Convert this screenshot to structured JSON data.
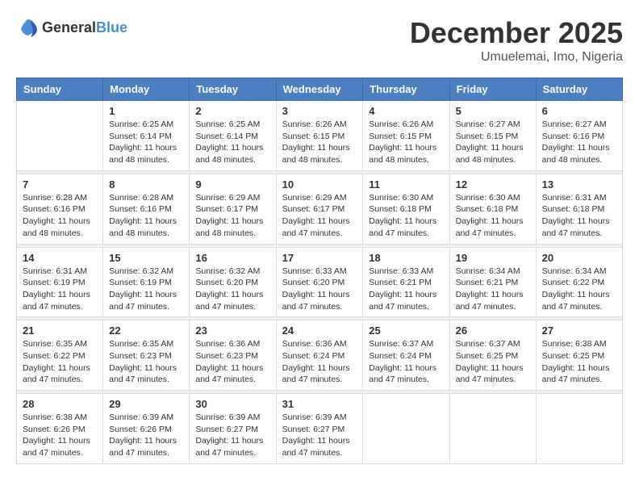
{
  "logo": {
    "general": "General",
    "blue": "Blue"
  },
  "header": {
    "month": "December 2025",
    "location": "Umuelemai, Imo, Nigeria"
  },
  "days_of_week": [
    "Sunday",
    "Monday",
    "Tuesday",
    "Wednesday",
    "Thursday",
    "Friday",
    "Saturday"
  ],
  "weeks": [
    [
      {
        "day": "",
        "info": ""
      },
      {
        "day": "1",
        "info": "Sunrise: 6:25 AM\nSunset: 6:14 PM\nDaylight: 11 hours\nand 48 minutes."
      },
      {
        "day": "2",
        "info": "Sunrise: 6:25 AM\nSunset: 6:14 PM\nDaylight: 11 hours\nand 48 minutes."
      },
      {
        "day": "3",
        "info": "Sunrise: 6:26 AM\nSunset: 6:15 PM\nDaylight: 11 hours\nand 48 minutes."
      },
      {
        "day": "4",
        "info": "Sunrise: 6:26 AM\nSunset: 6:15 PM\nDaylight: 11 hours\nand 48 minutes."
      },
      {
        "day": "5",
        "info": "Sunrise: 6:27 AM\nSunset: 6:15 PM\nDaylight: 11 hours\nand 48 minutes."
      },
      {
        "day": "6",
        "info": "Sunrise: 6:27 AM\nSunset: 6:16 PM\nDaylight: 11 hours\nand 48 minutes."
      }
    ],
    [
      {
        "day": "7",
        "info": "Sunrise: 6:28 AM\nSunset: 6:16 PM\nDaylight: 11 hours\nand 48 minutes."
      },
      {
        "day": "8",
        "info": "Sunrise: 6:28 AM\nSunset: 6:16 PM\nDaylight: 11 hours\nand 48 minutes."
      },
      {
        "day": "9",
        "info": "Sunrise: 6:29 AM\nSunset: 6:17 PM\nDaylight: 11 hours\nand 48 minutes."
      },
      {
        "day": "10",
        "info": "Sunrise: 6:29 AM\nSunset: 6:17 PM\nDaylight: 11 hours\nand 47 minutes."
      },
      {
        "day": "11",
        "info": "Sunrise: 6:30 AM\nSunset: 6:18 PM\nDaylight: 11 hours\nand 47 minutes."
      },
      {
        "day": "12",
        "info": "Sunrise: 6:30 AM\nSunset: 6:18 PM\nDaylight: 11 hours\nand 47 minutes."
      },
      {
        "day": "13",
        "info": "Sunrise: 6:31 AM\nSunset: 6:18 PM\nDaylight: 11 hours\nand 47 minutes."
      }
    ],
    [
      {
        "day": "14",
        "info": "Sunrise: 6:31 AM\nSunset: 6:19 PM\nDaylight: 11 hours\nand 47 minutes."
      },
      {
        "day": "15",
        "info": "Sunrise: 6:32 AM\nSunset: 6:19 PM\nDaylight: 11 hours\nand 47 minutes."
      },
      {
        "day": "16",
        "info": "Sunrise: 6:32 AM\nSunset: 6:20 PM\nDaylight: 11 hours\nand 47 minutes."
      },
      {
        "day": "17",
        "info": "Sunrise: 6:33 AM\nSunset: 6:20 PM\nDaylight: 11 hours\nand 47 minutes."
      },
      {
        "day": "18",
        "info": "Sunrise: 6:33 AM\nSunset: 6:21 PM\nDaylight: 11 hours\nand 47 minutes."
      },
      {
        "day": "19",
        "info": "Sunrise: 6:34 AM\nSunset: 6:21 PM\nDaylight: 11 hours\nand 47 minutes."
      },
      {
        "day": "20",
        "info": "Sunrise: 6:34 AM\nSunset: 6:22 PM\nDaylight: 11 hours\nand 47 minutes."
      }
    ],
    [
      {
        "day": "21",
        "info": "Sunrise: 6:35 AM\nSunset: 6:22 PM\nDaylight: 11 hours\nand 47 minutes."
      },
      {
        "day": "22",
        "info": "Sunrise: 6:35 AM\nSunset: 6:23 PM\nDaylight: 11 hours\nand 47 minutes."
      },
      {
        "day": "23",
        "info": "Sunrise: 6:36 AM\nSunset: 6:23 PM\nDaylight: 11 hours\nand 47 minutes."
      },
      {
        "day": "24",
        "info": "Sunrise: 6:36 AM\nSunset: 6:24 PM\nDaylight: 11 hours\nand 47 minutes."
      },
      {
        "day": "25",
        "info": "Sunrise: 6:37 AM\nSunset: 6:24 PM\nDaylight: 11 hours\nand 47 minutes."
      },
      {
        "day": "26",
        "info": "Sunrise: 6:37 AM\nSunset: 6:25 PM\nDaylight: 11 hours\nand 47 minutes."
      },
      {
        "day": "27",
        "info": "Sunrise: 6:38 AM\nSunset: 6:25 PM\nDaylight: 11 hours\nand 47 minutes."
      }
    ],
    [
      {
        "day": "28",
        "info": "Sunrise: 6:38 AM\nSunset: 6:26 PM\nDaylight: 11 hours\nand 47 minutes."
      },
      {
        "day": "29",
        "info": "Sunrise: 6:39 AM\nSunset: 6:26 PM\nDaylight: 11 hours\nand 47 minutes."
      },
      {
        "day": "30",
        "info": "Sunrise: 6:39 AM\nSunset: 6:27 PM\nDaylight: 11 hours\nand 47 minutes."
      },
      {
        "day": "31",
        "info": "Sunrise: 6:39 AM\nSunset: 6:27 PM\nDaylight: 11 hours\nand 47 minutes."
      },
      {
        "day": "",
        "info": ""
      },
      {
        "day": "",
        "info": ""
      },
      {
        "day": "",
        "info": ""
      }
    ]
  ]
}
